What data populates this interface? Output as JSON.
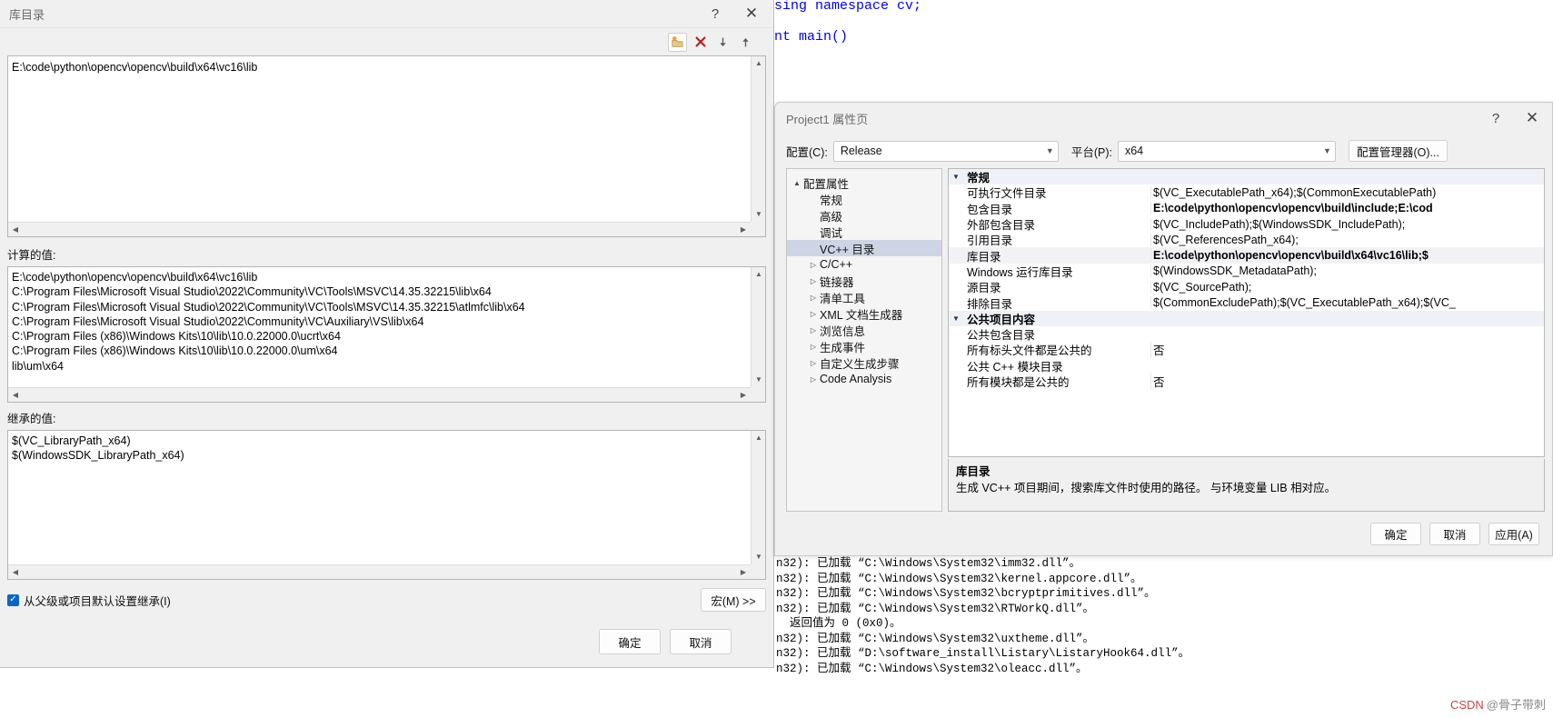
{
  "editor": {
    "lines": [
      "sing namespace cv;",
      "",
      "nt main()"
    ]
  },
  "lib_dialog": {
    "title": "库目录",
    "help_icon": "?",
    "close_icon": "✕",
    "toolbar": {
      "new_folder_label": "新行",
      "delete_label": "删除",
      "move_down_label": "下移",
      "move_up_label": "上移"
    },
    "edit_value": "E:\\code\\python\\opencv\\opencv\\build\\x64\\vc16\\lib",
    "computed_label": "计算的值:",
    "computed_values": [
      "E:\\code\\python\\opencv\\opencv\\build\\x64\\vc16\\lib",
      "C:\\Program Files\\Microsoft Visual Studio\\2022\\Community\\VC\\Tools\\MSVC\\14.35.32215\\lib\\x64",
      "C:\\Program Files\\Microsoft Visual Studio\\2022\\Community\\VC\\Tools\\MSVC\\14.35.32215\\atlmfc\\lib\\x64",
      "C:\\Program Files\\Microsoft Visual Studio\\2022\\Community\\VC\\Auxiliary\\VS\\lib\\x64",
      "C:\\Program Files (x86)\\Windows Kits\\10\\lib\\10.0.22000.0\\ucrt\\x64",
      "C:\\Program Files (x86)\\Windows Kits\\10\\lib\\10.0.22000.0\\um\\x64",
      "lib\\um\\x64"
    ],
    "inherited_label": "继承的值:",
    "inherited_values": [
      "$(VC_LibraryPath_x64)",
      "$(WindowsSDK_LibraryPath_x64)"
    ],
    "inherit_checkbox_label": "从父级或项目默认设置继承(I)",
    "inherit_checked": true,
    "macro_button": "宏(M) >>",
    "ok_button": "确定",
    "cancel_button": "取消"
  },
  "prop_dialog": {
    "title": "Project1 属性页",
    "help_icon": "?",
    "close_icon": "✕",
    "config_label": "配置(C):",
    "config_value": "Release",
    "platform_label": "平台(P):",
    "platform_value": "x64",
    "config_manager_button": "配置管理器(O)...",
    "tree": [
      {
        "label": "配置属性",
        "twisty": "▲",
        "indent": 0,
        "selected": false
      },
      {
        "label": "常规",
        "twisty": "",
        "indent": 1,
        "selected": false
      },
      {
        "label": "高级",
        "twisty": "",
        "indent": 1,
        "selected": false
      },
      {
        "label": "调试",
        "twisty": "",
        "indent": 1,
        "selected": false
      },
      {
        "label": "VC++ 目录",
        "twisty": "",
        "indent": 1,
        "selected": true
      },
      {
        "label": "C/C++",
        "twisty": "▷",
        "indent": 1,
        "selected": false
      },
      {
        "label": "链接器",
        "twisty": "▷",
        "indent": 1,
        "selected": false
      },
      {
        "label": "清单工具",
        "twisty": "▷",
        "indent": 1,
        "selected": false
      },
      {
        "label": "XML 文档生成器",
        "twisty": "▷",
        "indent": 1,
        "selected": false
      },
      {
        "label": "浏览信息",
        "twisty": "▷",
        "indent": 1,
        "selected": false
      },
      {
        "label": "生成事件",
        "twisty": "▷",
        "indent": 1,
        "selected": false
      },
      {
        "label": "自定义生成步骤",
        "twisty": "▷",
        "indent": 1,
        "selected": false
      },
      {
        "label": "Code Analysis",
        "twisty": "▷",
        "indent": 1,
        "selected": false
      }
    ],
    "grid": [
      {
        "kind": "group",
        "name": "常规",
        "value": "",
        "twisty": "⌄"
      },
      {
        "kind": "row",
        "name": "可执行文件目录",
        "value": "$(VC_ExecutablePath_x64);$(CommonExecutablePath)",
        "bold": false
      },
      {
        "kind": "row",
        "name": "包含目录",
        "value": "E:\\code\\python\\opencv\\opencv\\build\\include;E:\\cod",
        "bold": true
      },
      {
        "kind": "row",
        "name": "外部包含目录",
        "value": "$(VC_IncludePath);$(WindowsSDK_IncludePath);",
        "bold": false
      },
      {
        "kind": "row",
        "name": "引用目录",
        "value": "$(VC_ReferencesPath_x64);",
        "bold": false
      },
      {
        "kind": "row",
        "name": "库目录",
        "value": "E:\\code\\python\\opencv\\opencv\\build\\x64\\vc16\\lib;$",
        "bold": true,
        "highlight": true
      },
      {
        "kind": "row",
        "name": "Windows 运行库目录",
        "value": "$(WindowsSDK_MetadataPath);",
        "bold": false
      },
      {
        "kind": "row",
        "name": "源目录",
        "value": "$(VC_SourcePath);",
        "bold": false
      },
      {
        "kind": "row",
        "name": "排除目录",
        "value": "$(CommonExcludePath);$(VC_ExecutablePath_x64);$(VC_",
        "bold": false
      },
      {
        "kind": "group",
        "name": "公共项目内容",
        "value": "",
        "twisty": "⌄"
      },
      {
        "kind": "row",
        "name": "公共包含目录",
        "value": "",
        "bold": false
      },
      {
        "kind": "row",
        "name": "所有标头文件都是公共的",
        "value": "否",
        "bold": false
      },
      {
        "kind": "row",
        "name": "公共 C++ 模块目录",
        "value": "",
        "bold": false
      },
      {
        "kind": "row",
        "name": "所有模块都是公共的",
        "value": "否",
        "bold": false
      }
    ],
    "description": {
      "title": "库目录",
      "text": "生成 VC++ 项目期间，搜索库文件时使用的路径。  与环境变量 LIB 相对应。"
    },
    "ok_button": "确定",
    "cancel_button": "取消",
    "apply_button": "应用(A)"
  },
  "console": {
    "lines": [
      "n32): 已加载 “C:\\Windows\\System32\\imm32.dll”。",
      "n32): 已加载 “C:\\Windows\\System32\\kernel.appcore.dll”。",
      "n32): 已加载 “C:\\Windows\\System32\\bcryptprimitives.dll”。",
      "n32): 已加载 “C:\\Windows\\System32\\RTWorkQ.dll”。",
      "  返回值为 0 (0x0)。",
      "n32): 已加载 “C:\\Windows\\System32\\uxtheme.dll”。",
      "n32): 已加载 “D:\\software_install\\Listary\\ListaryHook64.dll”。",
      "n32): 已加载 “C:\\Windows\\System32\\oleacc.dll”。"
    ]
  },
  "watermark": {
    "brand": "CSDN",
    "author": "@骨子带刺"
  }
}
